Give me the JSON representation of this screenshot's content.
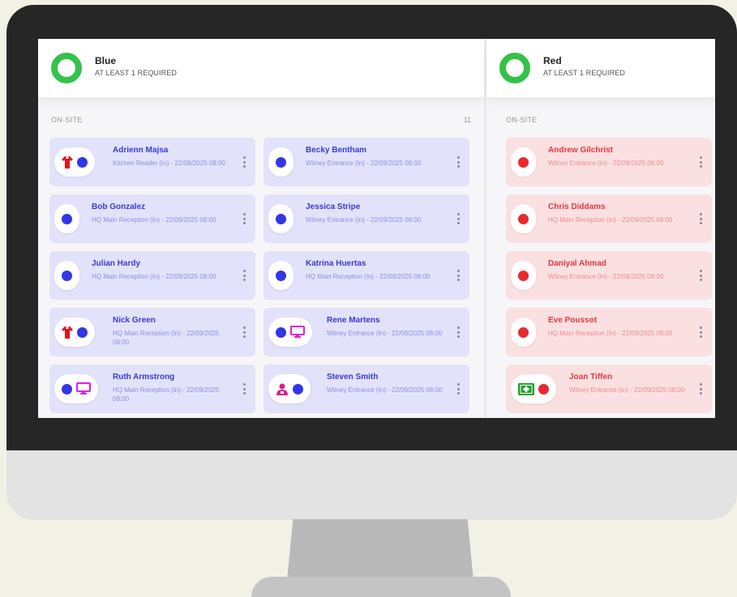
{
  "groups": {
    "blue": {
      "name": "Blue",
      "requirement": "AT LEAST 1 REQUIRED",
      "section_label": "ON-SITE",
      "count": "11",
      "people": [
        {
          "name": "Adrienn Majsa",
          "detail": "Kitchen Reader (In) - 22/09/2025 08:00",
          "icons": [
            "fire-warden-vest-icon"
          ]
        },
        {
          "name": "Becky Bentham",
          "detail": "Witney Entrance (In) - 22/09/2025 08:00",
          "icons": []
        },
        {
          "name": "Bob Gonzalez",
          "detail": "HQ Main Reception (In) - 22/09/2025 08:00",
          "icons": []
        },
        {
          "name": "Jessica Stripe",
          "detail": "Witney Entrance (In) - 22/09/2025 08:00",
          "icons": []
        },
        {
          "name": "Julian Hardy",
          "detail": "HQ Main Reception (In) - 22/09/2025 08:00",
          "icons": []
        },
        {
          "name": "Katrina Huertas",
          "detail": "HQ Main Reception (In) - 22/09/2025 08:00",
          "icons": []
        },
        {
          "name": "Nick Green",
          "detail": "HQ Main Reception (In) - 22/09/2025 08:00",
          "icons": [
            "fire-warden-vest-icon"
          ]
        },
        {
          "name": "Rene Martens",
          "detail": "Witney Entrance (In) - 22/09/2025 08:00",
          "icons": [
            "remote-monitor-icon"
          ]
        },
        {
          "name": "Ruth Armstrong",
          "detail": "HQ Main Reception (In) - 22/09/2025 08:00",
          "icons": [
            "remote-monitor-icon"
          ]
        },
        {
          "name": "Steven Smith",
          "detail": "Witney Entrance (In) - 22/09/2025 08:00",
          "icons": [
            "visitor-host-icon"
          ]
        }
      ]
    },
    "red": {
      "name": "Red",
      "requirement": "AT LEAST 1 REQUIRED",
      "section_label": "ON-SITE",
      "people": [
        {
          "name": "Andrew Gilchrist",
          "detail": "Witney Entrance (In) - 22/09/2025 08:00",
          "icons": []
        },
        {
          "name": "Chris Diddams",
          "detail": "HQ Main Reception (In) - 22/09/2025 08:00",
          "icons": []
        },
        {
          "name": "Daniyal Ahmad",
          "detail": "Witney Entrance (In) - 22/09/2025 08:00",
          "icons": []
        },
        {
          "name": "Eve Poussot",
          "detail": "HQ Main Reception (In) - 22/09/2025 08:00",
          "icons": []
        },
        {
          "name": "Joan Tiffen",
          "detail": "Witney Entrance (In) - 22/09/2025 08:00",
          "icons": [
            "first-aid-kit-icon"
          ]
        }
      ]
    }
  },
  "colors": {
    "ring": "#34c24a",
    "blue_dot": "#3236e6",
    "red_dot": "#e82a2e",
    "blue_card": "#e2e2fa",
    "red_card": "#fbe0e1",
    "fire_warden": "#e0121a",
    "monitor_icon": "#e11ee0",
    "host_icon": "#d61f8a",
    "first_aid": "#22a12e"
  }
}
